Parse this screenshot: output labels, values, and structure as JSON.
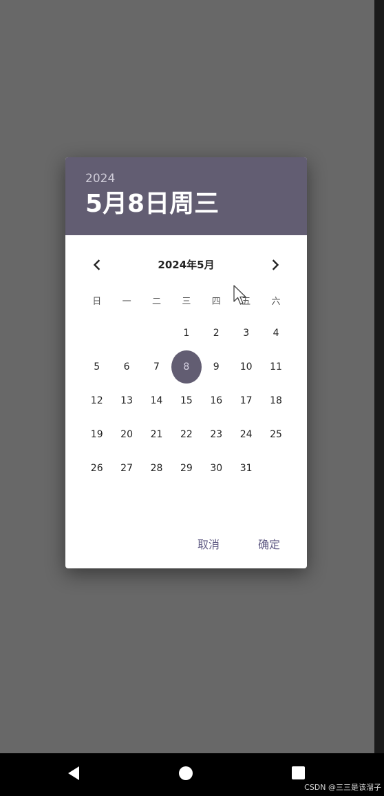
{
  "header": {
    "year": "2024",
    "selected_date": "5月8日周三"
  },
  "calendar": {
    "month_label": "2024年5月",
    "prev_icon": "chevron-left-icon",
    "next_icon": "chevron-right-icon",
    "weekdays": [
      "日",
      "一",
      "二",
      "三",
      "四",
      "五",
      "六"
    ],
    "weeks": [
      [
        "",
        "",
        "",
        "1",
        "2",
        "3",
        "4"
      ],
      [
        "5",
        "6",
        "7",
        "8",
        "9",
        "10",
        "11"
      ],
      [
        "12",
        "13",
        "14",
        "15",
        "16",
        "17",
        "18"
      ],
      [
        "19",
        "20",
        "21",
        "22",
        "23",
        "24",
        "25"
      ],
      [
        "26",
        "27",
        "28",
        "29",
        "30",
        "31",
        ""
      ]
    ],
    "selected_day": "8"
  },
  "actions": {
    "cancel_label": "取消",
    "ok_label": "确定"
  },
  "watermark": "CSDN @三三是该溜子",
  "colors": {
    "header_bg": "#625d72",
    "accent": "#625d86",
    "scrim": "#686868"
  }
}
